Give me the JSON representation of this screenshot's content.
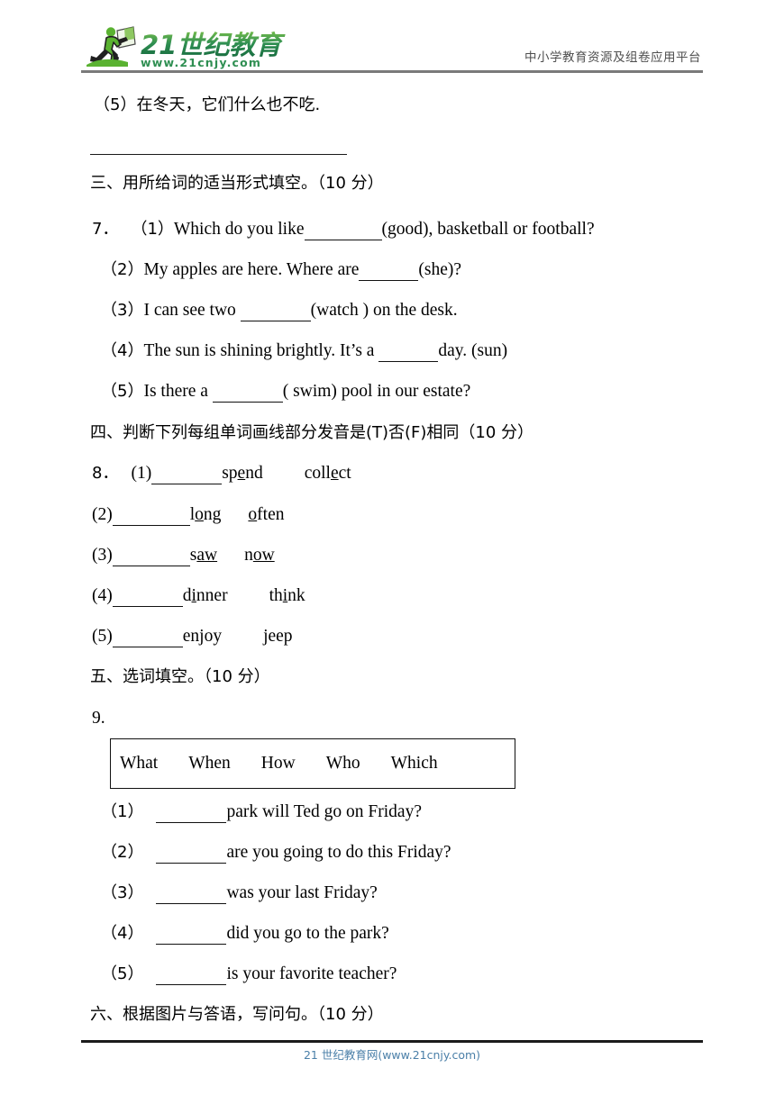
{
  "header": {
    "logo": {
      "icon_name": "running-person-with-flag-icon",
      "brand_text": "21世纪教育",
      "brand_number": "21",
      "brand_cn": "世纪教育",
      "brand_url": "www.21cnjy.com",
      "color_dark_green": "#18784a",
      "color_light_green": "#6cb33f"
    },
    "tagline": "中小学教育资源及组卷应用平台"
  },
  "content": {
    "carryover_item": {
      "number": "（5）",
      "text": "在冬天，它们什么也不吃."
    },
    "section_three": {
      "heading": "三、用所给词的适当形式填空。（10 分）",
      "question_number": "7．",
      "items": [
        {
          "label": "（1）",
          "before": "Which do you like",
          "after": "(good), basketball or football?"
        },
        {
          "label": "（2）",
          "before": "My apples are here. Where are",
          "after": "(she)?"
        },
        {
          "label": "（3）",
          "before": "I can see two ",
          "after": "(watch ) on the desk."
        },
        {
          "label": "（4）",
          "before": "The sun is shining brightly. It’s a ",
          "after": "day. (sun)"
        },
        {
          "label": "（5）",
          "before": "Is there a ",
          "after": "( swim) pool in our estate?"
        }
      ]
    },
    "section_four": {
      "heading": "四、判断下列每组单词画线部分发音是(T)否(F)相同（10 分）",
      "question_number": "8．",
      "items": [
        {
          "label": "(1)",
          "word_a_pre": "sp",
          "word_a_ul": "e",
          "word_a_post": "nd",
          "word_b_pre": "coll",
          "word_b_ul": "e",
          "word_b_post": "ct"
        },
        {
          "label": "(2)",
          "word_a_pre": "l",
          "word_a_ul": "o",
          "word_a_post": "ng",
          "word_b_pre": "",
          "word_b_ul": "o",
          "word_b_post": "ften"
        },
        {
          "label": "(3)",
          "word_a_pre": "s",
          "word_a_ul": "aw",
          "word_a_post": "",
          "word_b_pre": "n",
          "word_b_ul": "ow",
          "word_b_post": ""
        },
        {
          "label": "(4)",
          "word_a_pre": "d",
          "word_a_ul": "i",
          "word_a_post": "nner",
          "word_b_pre": "th",
          "word_b_ul": "i",
          "word_b_post": "nk"
        },
        {
          "label": "(5)",
          "word_a_pre": "en",
          "word_a_ul": "j",
          "word_a_post": "oy",
          "word_b_pre": "",
          "word_b_ul": "j",
          "word_b_post": "eep"
        }
      ]
    },
    "section_five": {
      "heading": "五、选词填空。（10 分）",
      "question_number": "9.",
      "word_bank": [
        "What",
        "When",
        "How",
        "Who",
        "Which"
      ],
      "items": [
        {
          "label": "（1）",
          "text": "park will Ted go on Friday?"
        },
        {
          "label": "（2）",
          "text": "are you going to do this Friday?"
        },
        {
          "label": "（3）",
          "text": "was your last Friday?"
        },
        {
          "label": "（4）",
          "text": "did you go to the park?"
        },
        {
          "label": "（5）",
          "text": "is your favorite teacher?"
        }
      ]
    },
    "section_six": {
      "heading": "六、根据图片与答语，写问句。（10 分）"
    }
  },
  "footer": {
    "text": "21 世纪教育网(www.21cnjy.com)",
    "color": "#4a7fa8"
  }
}
